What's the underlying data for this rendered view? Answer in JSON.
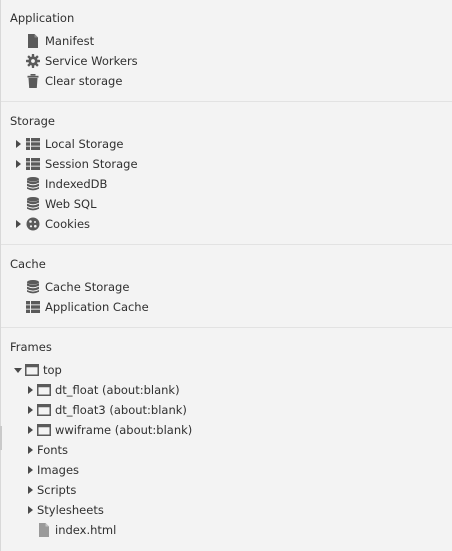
{
  "sections": {
    "application": {
      "title": "Application",
      "items": [
        {
          "label": "Manifest",
          "icon": "document-icon"
        },
        {
          "label": "Service Workers",
          "icon": "gear-icon"
        },
        {
          "label": "Clear storage",
          "icon": "trash-icon"
        }
      ]
    },
    "storage": {
      "title": "Storage",
      "items": [
        {
          "label": "Local Storage",
          "icon": "grid-icon",
          "expandable": true
        },
        {
          "label": "Session Storage",
          "icon": "grid-icon",
          "expandable": true
        },
        {
          "label": "IndexedDB",
          "icon": "database-icon"
        },
        {
          "label": "Web SQL",
          "icon": "database-icon"
        },
        {
          "label": "Cookies",
          "icon": "cookie-icon",
          "expandable": true
        }
      ]
    },
    "cache": {
      "title": "Cache",
      "items": [
        {
          "label": "Cache Storage",
          "icon": "database-icon"
        },
        {
          "label": "Application Cache",
          "icon": "grid-icon"
        }
      ]
    },
    "frames": {
      "title": "Frames",
      "top": {
        "label": "top",
        "icon": "frame-icon",
        "expanded": true
      },
      "children": [
        {
          "label": "dt_float (about:blank)",
          "icon": "frame-icon"
        },
        {
          "label": "dt_float3 (about:blank)",
          "icon": "frame-icon"
        },
        {
          "label": "wwiframe (about:blank)",
          "icon": "frame-icon"
        },
        {
          "label": "Fonts"
        },
        {
          "label": "Images"
        },
        {
          "label": "Scripts"
        },
        {
          "label": "Stylesheets"
        },
        {
          "label": "index.html",
          "icon": "file-icon"
        }
      ]
    }
  },
  "colors": {
    "background": "#f3f3f3",
    "text": "#303030",
    "icon": "#5a5a5a",
    "divider": "#e2e2e2"
  }
}
